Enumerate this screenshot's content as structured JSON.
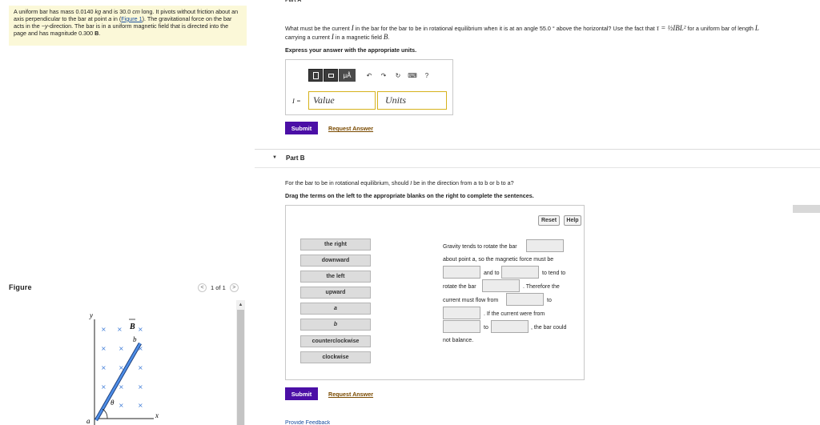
{
  "problem": {
    "text_a": "A uniform bar has mass 0.0140 ",
    "unit_kg": "kg",
    "text_b": " and is 30.0 ",
    "unit_cm": "cm",
    "text_c": " long. It pivots without friction about an axis perpendicular to the bar at point ",
    "point_a": "a",
    "text_d": " in (",
    "figure_link": "Figure 1",
    "text_e": "). The gravitational force on the bar acts in the ",
    "direction": "−y",
    "text_f": "-direction. The bar is in a uniform magnetic field that is directed into the page and has magnitude 0.300 ",
    "field_B": "B",
    "text_g": "."
  },
  "figure": {
    "label": "Figure",
    "pager_text": "1 of 1",
    "prev_symbol": "<",
    "next_symbol": ">",
    "axis_y": "y",
    "axis_x": "x",
    "field_label": "B",
    "point_b": "b",
    "point_a": "a",
    "angle_label": "θ",
    "cross": "×"
  },
  "partA": {
    "tab": "Part A",
    "question_1": "What must be the current ",
    "var_I": "I",
    "question_2": " in the bar for the bar to be in rotational equilibrium when it is at an angle 55.0 ° above the horizontal? Use the fact that ",
    "formula": "τ = ½IBL²",
    "question_3": " for a uniform bar of length ",
    "var_L": "L",
    "question_4": " carrying a current ",
    "question_5": " in a magnetic field ",
    "var_B": "B",
    "question_6": ".",
    "instruction": "Express your answer with the appropriate units.",
    "toolbar": {
      "mu_a": "μÅ",
      "undo": "↶",
      "redo": "↷",
      "reset": "↻",
      "keyboard": "⌨",
      "help": "?"
    },
    "eq_label": "I =",
    "value_placeholder": "Value",
    "units_placeholder": "Units",
    "submit": "Submit",
    "request": "Request Answer"
  },
  "partB": {
    "caret": "▼",
    "title": "Part B",
    "question_1": "For the bar to be in rotational equilibrium, should ",
    "var_I": "I",
    "question_2": " be in the direction from a to b or b to a?",
    "instruction": "Drag the terms on the left to the appropriate blanks on the right to complete the sentences.",
    "reset": "Reset",
    "help": "Help",
    "terms": [
      "the right",
      "downward",
      "the left",
      "upward",
      "a",
      "b",
      "counterclockwise",
      "clockwise"
    ],
    "sentences": {
      "s1": "Gravity tends to rotate the bar",
      "s2": "about point a, so the magnetic force must be",
      "s3": "and to",
      "s4": "to tend to",
      "s5": "rotate the bar",
      "s6": ". Therefore the",
      "s7": "current must flow from",
      "s8": "to",
      "s9": ". If the current were from",
      "s10": "to",
      "s11": ", the bar could",
      "s12": "not balance."
    },
    "submit": "Submit",
    "request": "Request Answer"
  },
  "footer": {
    "feedback": "Provide Feedback"
  }
}
